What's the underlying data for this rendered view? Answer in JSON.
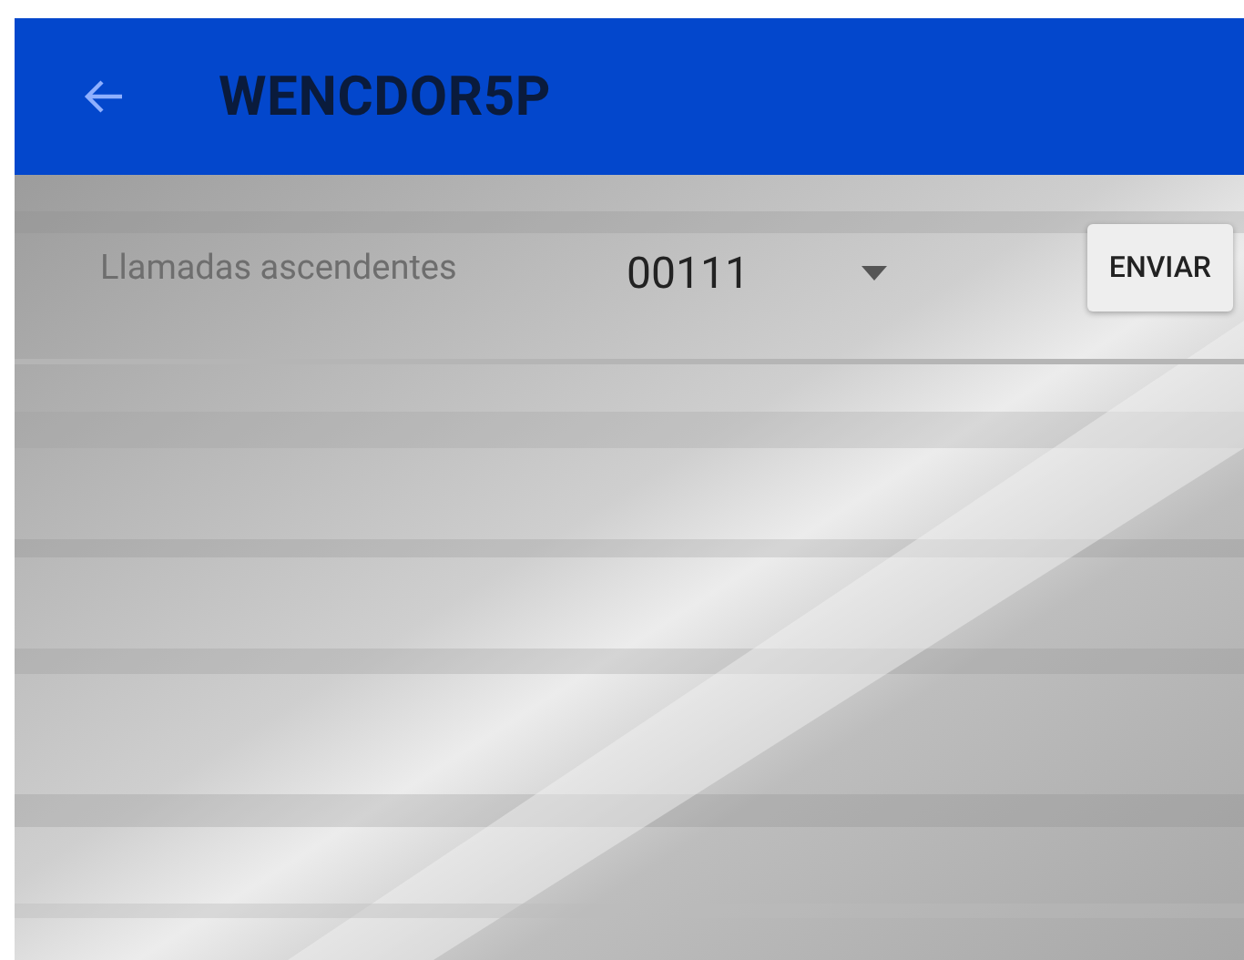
{
  "app_bar": {
    "title": "WENCDOR5P"
  },
  "form": {
    "label": "Llamadas ascendentes",
    "dropdown": {
      "value": "00111"
    },
    "button": "ENVIAR"
  }
}
